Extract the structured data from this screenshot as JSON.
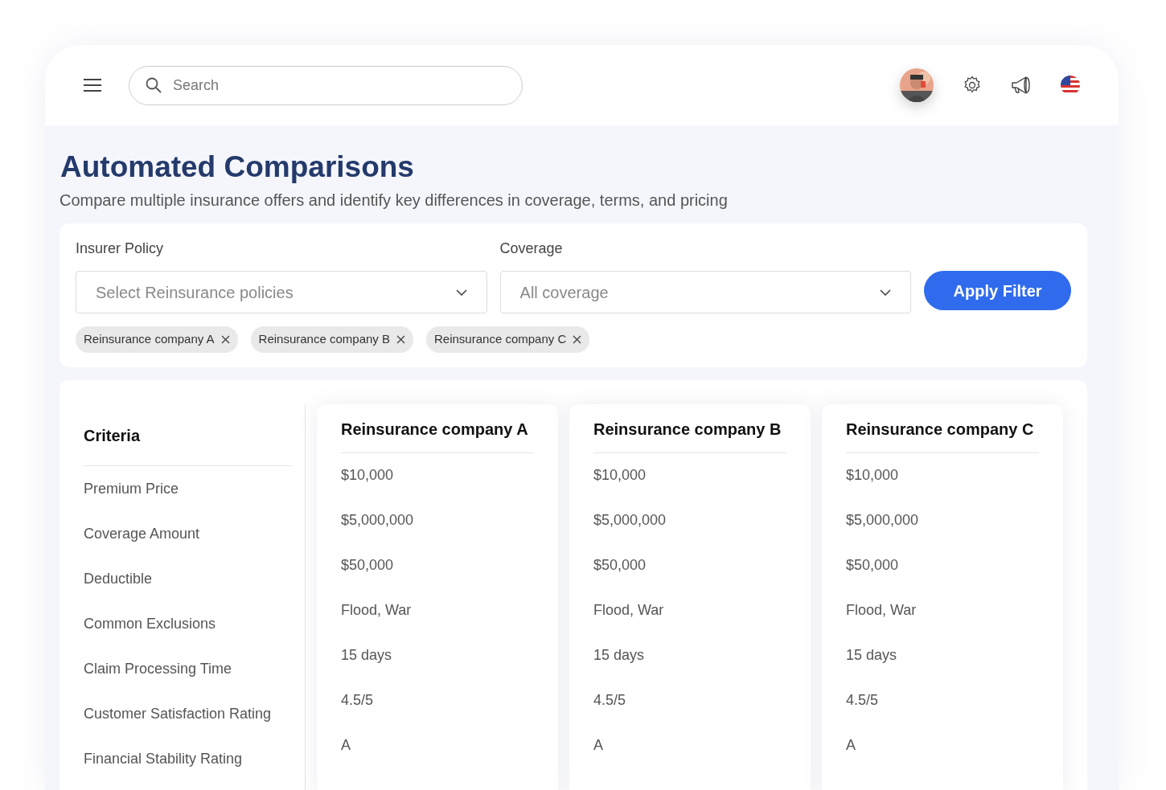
{
  "search": {
    "placeholder": "Search"
  },
  "page": {
    "title": "Automated Comparisons",
    "subtitle": "Compare multiple insurance offers and identify key differences in coverage, terms, and pricing"
  },
  "filters": {
    "fields": [
      {
        "label": "Insurer Policy",
        "placeholder": "Select Reinsurance policies"
      },
      {
        "label": "Coverage",
        "placeholder": "All coverage"
      }
    ],
    "apply_button": "Apply Filter",
    "chips": [
      "Reinsurance company A",
      "Reinsurance company B",
      "Reinsurance company C"
    ]
  },
  "comparison": {
    "criteria_title": "Criteria",
    "criteria": [
      "Premium Price",
      "Coverage Amount",
      "Deductible",
      "Common Exclusions",
      "Claim Processing Time",
      "Customer Satisfaction Rating",
      "Financial Stability Rating"
    ],
    "companies": [
      {
        "name": "Reinsurance company A",
        "values": [
          "$10,000",
          "$5,000,000",
          "$50,000",
          "Flood, War",
          "15 days",
          "4.5/5",
          "A"
        ]
      },
      {
        "name": "Reinsurance company B",
        "values": [
          "$10,000",
          "$5,000,000",
          "$50,000",
          "Flood, War",
          "15 days",
          "4.5/5",
          "A"
        ]
      },
      {
        "name": "Reinsurance company C",
        "values": [
          "$10,000",
          "$5,000,000",
          "$50,000",
          "Flood, War",
          "15 days",
          "4.5/5",
          "A"
        ]
      }
    ]
  }
}
